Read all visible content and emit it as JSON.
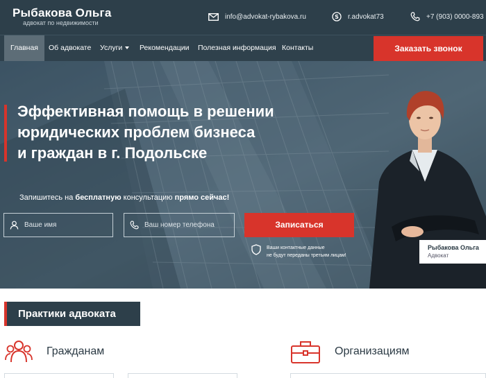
{
  "brand": {
    "name": "Рыбакова Ольга",
    "tagline": "адвокат по недвижимости"
  },
  "contacts": {
    "email": "info@advokat-rybakova.ru",
    "skype": "r.advokat73",
    "phone": "+7 (903) 0000-893"
  },
  "nav": {
    "items": [
      {
        "label": "Главная",
        "active": true
      },
      {
        "label": "Об адвокате"
      },
      {
        "label": "Услуги",
        "dropdown": true
      },
      {
        "label": "Рекомендации"
      },
      {
        "label": "Полезная информация"
      },
      {
        "label": "Контакты"
      }
    ],
    "callback_label": "Заказать звонок"
  },
  "hero": {
    "title_lines": [
      "Эффективная помощь в решении",
      "юридических проблем бизнеса",
      "и граждан в г. Подольске"
    ],
    "cta_prefix": "Запишитесь на ",
    "cta_bold1": "бесплатную",
    "cta_middle": " консультацию ",
    "cta_bold2": "прямо сейчас!",
    "name_placeholder": "Ваше имя",
    "phone_placeholder": "Ваш номер телефона",
    "submit_label": "Записаться",
    "privacy_line1": "Ваши контактные данные",
    "privacy_line2": "не будут переданы третьим лицам!",
    "card_name": "Рыбакова Ольга",
    "card_role": "Адвокат"
  },
  "practices": {
    "heading": "Практики адвоката",
    "categories": [
      {
        "label": "Гражданам",
        "icon": "people-icon"
      },
      {
        "label": "Организациям",
        "icon": "briefcase-icon"
      }
    ]
  },
  "colors": {
    "accent": "#d8342b",
    "dark": "#2d3f4a",
    "nav_active": "#5d6d77"
  }
}
